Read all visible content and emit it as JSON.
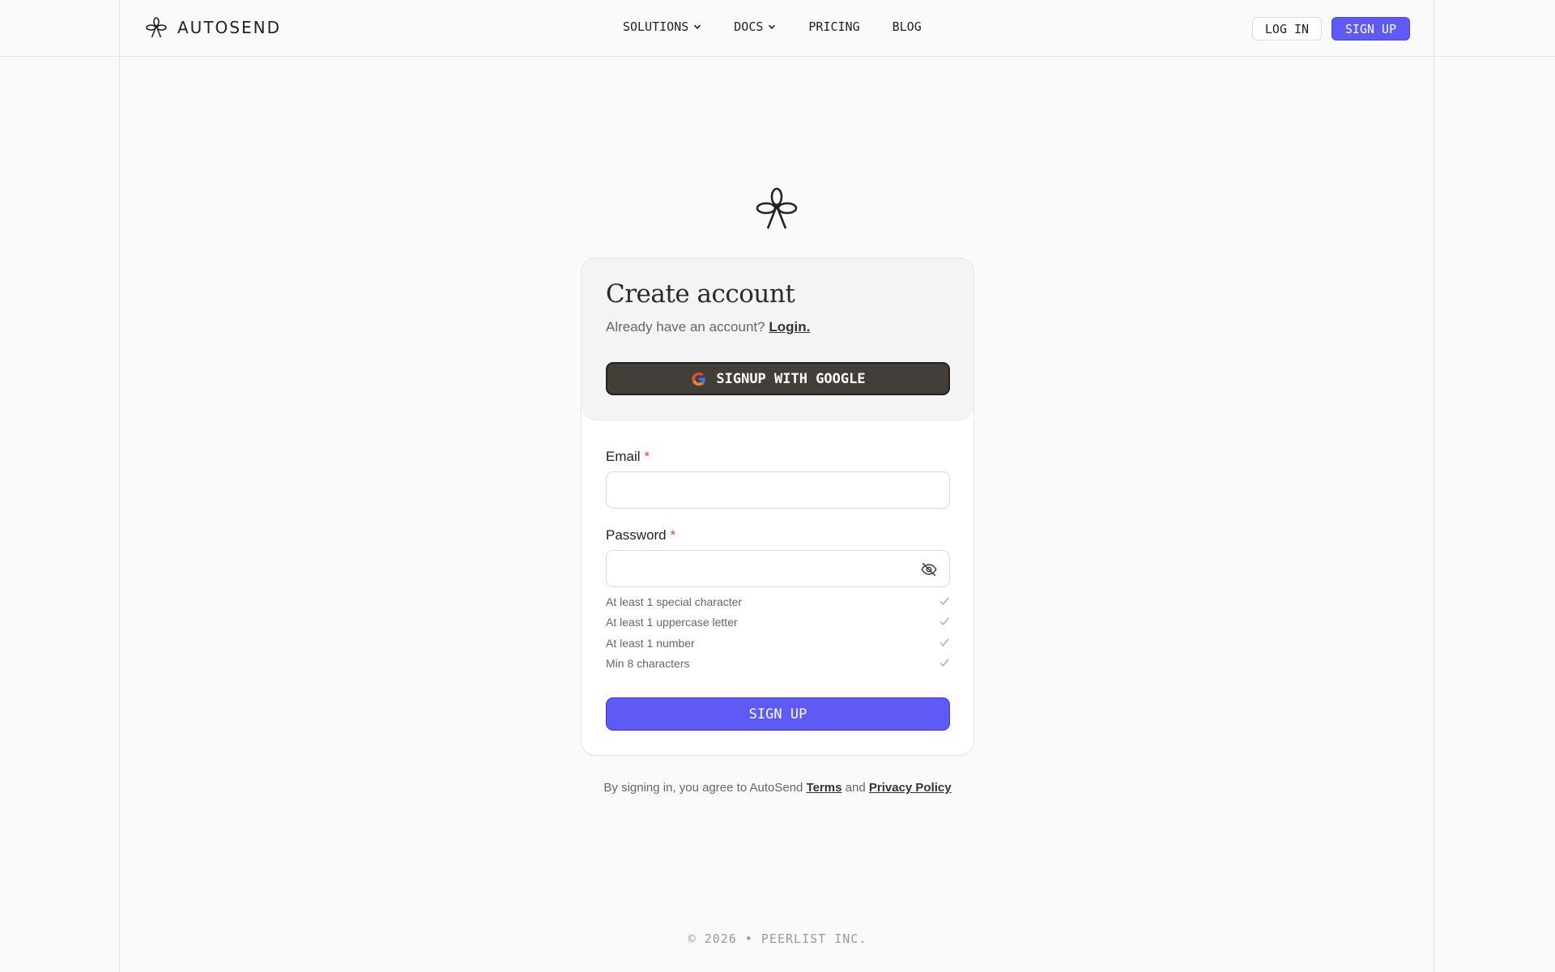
{
  "header": {
    "brand": "AUTOSEND",
    "nav": [
      {
        "label": "SOLUTIONS",
        "dropdown": true
      },
      {
        "label": "DOCS",
        "dropdown": true
      },
      {
        "label": "PRICING",
        "dropdown": false
      },
      {
        "label": "BLOG",
        "dropdown": false
      }
    ],
    "login_label": "LOG IN",
    "signup_label": "SIGN UP"
  },
  "form": {
    "title": "Create account",
    "have_account": "Already have an account?",
    "login_link": "Login.",
    "google_label": "SIGNUP WITH GOOGLE",
    "email_label": "Email",
    "email_value": "",
    "password_label": "Password",
    "password_value": "",
    "required_mark": "*",
    "rules": [
      "At least 1 special character",
      "At least 1 uppercase letter",
      "At least 1 number",
      "Min 8 characters"
    ],
    "submit_label": "SIGN UP"
  },
  "legal": {
    "prefix": "By signing in, you agree to AutoSend",
    "terms": "Terms",
    "and": "and",
    "privacy": "Privacy Policy"
  },
  "footer": {
    "copyright": "© 2026 • PEERLIST INC."
  },
  "colors": {
    "accent": "#5f5af6",
    "dark_button": "#433e38",
    "required": "#e0452c"
  },
  "icons": [
    "autosend-logo-icon",
    "chevron-down-icon",
    "google-icon",
    "eye-off-icon",
    "check-icon"
  ]
}
